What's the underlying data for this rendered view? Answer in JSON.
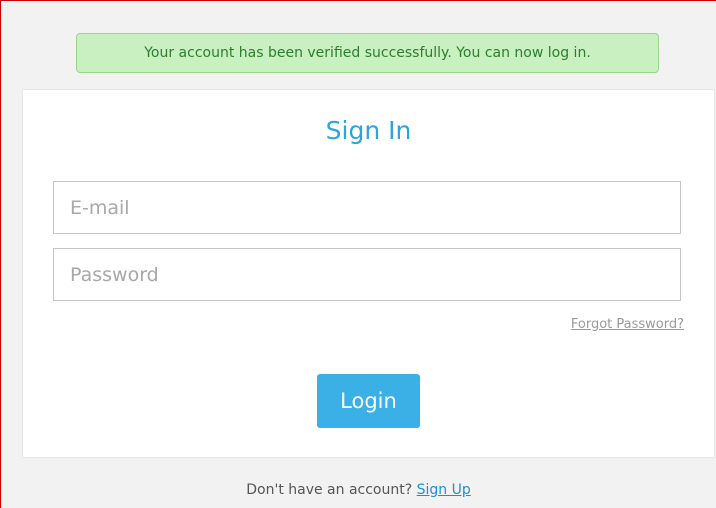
{
  "alert": {
    "message": "Your account has been verified successfully. You can now log in."
  },
  "signin": {
    "title": "Sign In",
    "email_placeholder": "E-mail",
    "password_placeholder": "Password",
    "forgot_label": "Forgot Password?",
    "login_label": "Login"
  },
  "footer": {
    "prompt": "Don't have an account?",
    "signup_label": "Sign Up"
  },
  "colors": {
    "accent": "#2ea3dd",
    "button": "#3ab0e6",
    "alert_bg": "#c8f0c0",
    "alert_text": "#2e7d2e",
    "link": "#1f8ed6"
  }
}
